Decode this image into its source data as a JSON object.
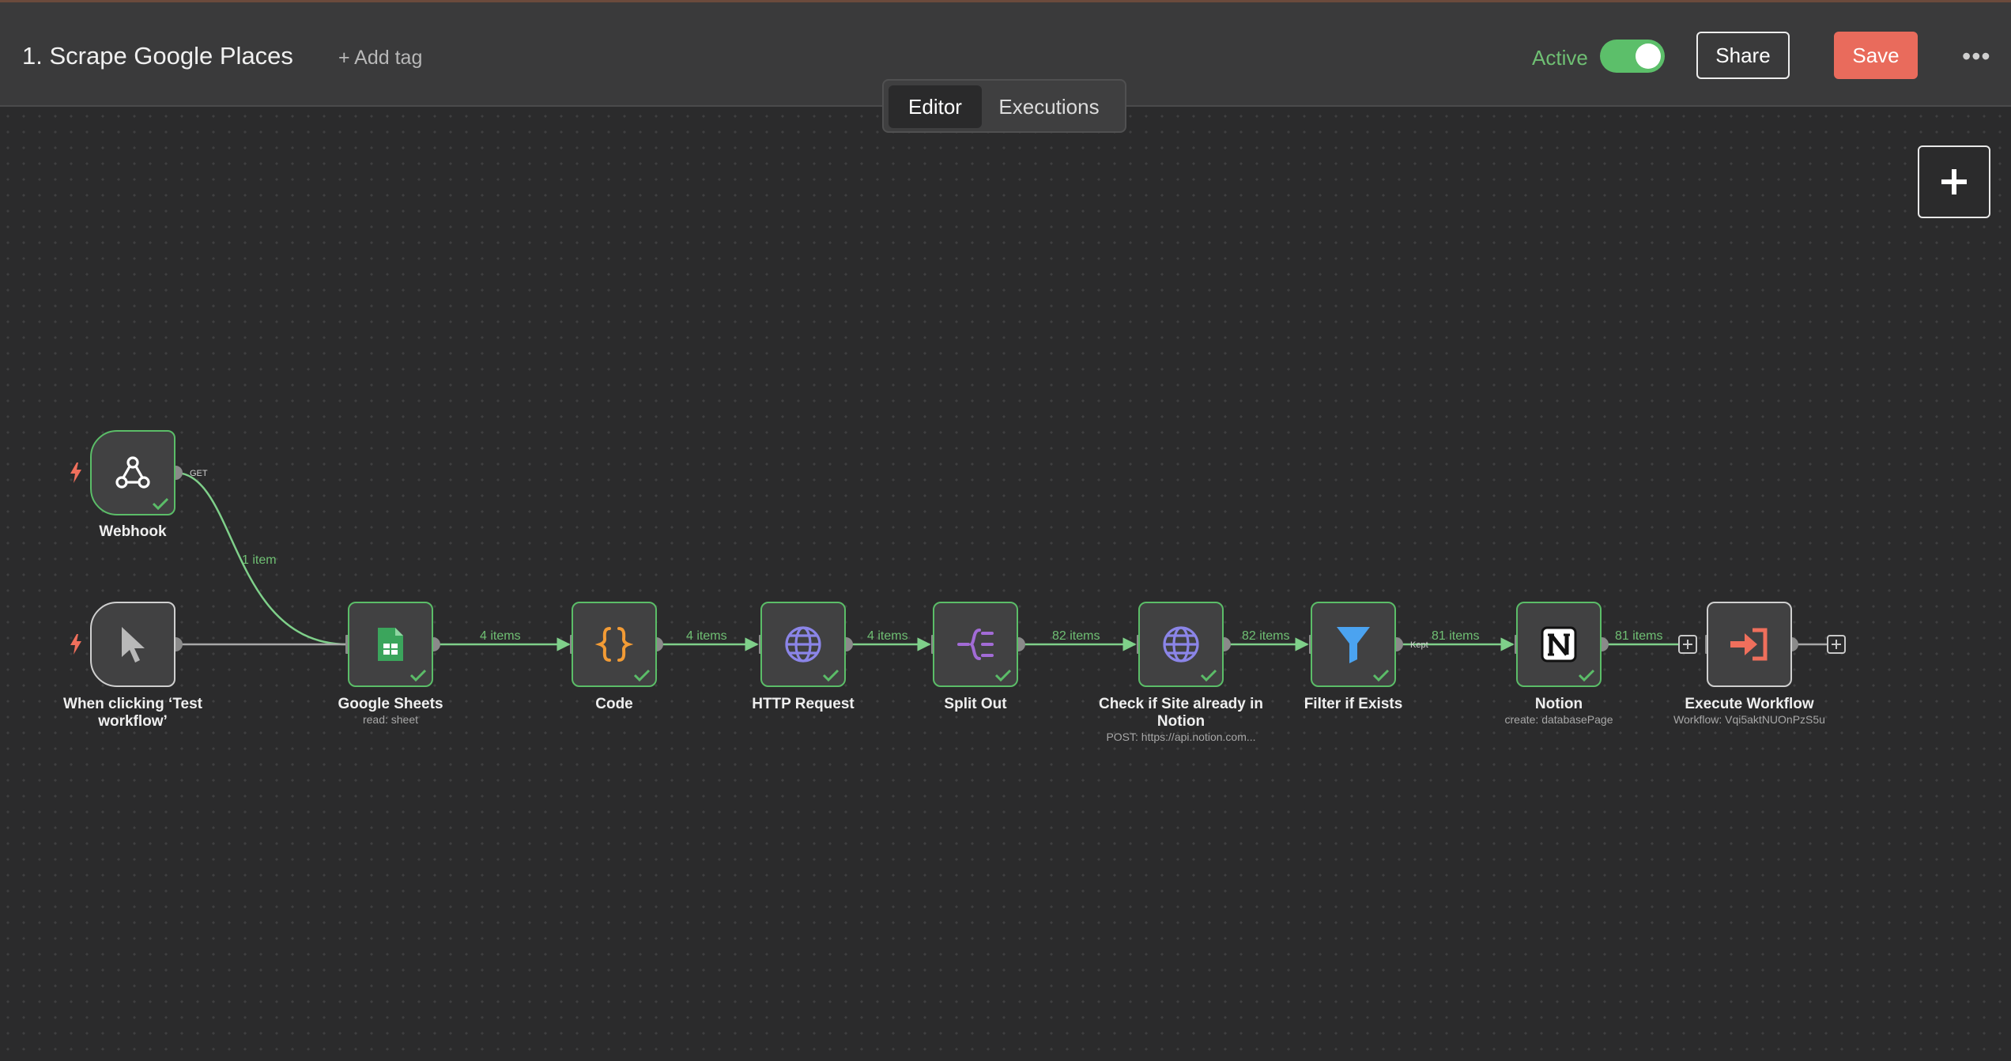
{
  "header": {
    "workflow_title": "1. Scrape Google Places",
    "add_tag": "+ Add tag",
    "active_label": "Active",
    "share_label": "Share",
    "save_label": "Save",
    "more_label": "•••"
  },
  "tabs": [
    {
      "label": "Editor",
      "selected": true
    },
    {
      "label": "Executions",
      "selected": false
    }
  ],
  "colors": {
    "success": "#5bbd68",
    "accent": "#e96b5c",
    "background": "#2b2b2c"
  },
  "nodes": [
    {
      "label": "Webhook",
      "subtitle": "",
      "icon": "webhook-icon",
      "executed": true
    },
    {
      "label": "When clicking ‘Test workflow’",
      "subtitle": "",
      "icon": "cursor-icon",
      "executed": false
    },
    {
      "label": "Google Sheets",
      "subtitle": "read: sheet",
      "icon": "google-sheets-icon",
      "executed": true
    },
    {
      "label": "Code",
      "subtitle": "",
      "icon": "code-braces-icon",
      "executed": true
    },
    {
      "label": "HTTP Request",
      "subtitle": "",
      "icon": "globe-icon",
      "executed": true
    },
    {
      "label": "Split Out",
      "subtitle": "",
      "icon": "split-out-icon",
      "executed": true
    },
    {
      "label": "Check if Site already in Notion",
      "subtitle": "POST: https://api.notion.com...",
      "icon": "globe-icon",
      "executed": true
    },
    {
      "label": "Filter if Exists",
      "subtitle": "",
      "icon": "filter-icon",
      "executed": true
    },
    {
      "label": "Notion",
      "subtitle": "create: databasePage",
      "icon": "notion-icon",
      "executed": true
    },
    {
      "label": "Execute Workflow",
      "subtitle": "Workflow: Vqi5aktNUOnPzS5u",
      "icon": "execute-workflow-icon",
      "executed": false
    }
  ],
  "connections": {
    "webhook_method": "GET",
    "webhook_to_sheets": "1 item",
    "sheets_to_code": "4 items",
    "code_to_http": "4 items",
    "http_to_split": "4 items",
    "split_to_check": "82 items",
    "check_to_filter": "82 items",
    "filter_output": "Kept",
    "filter_to_notion": "81 items",
    "notion_to_execute": "81 items"
  }
}
